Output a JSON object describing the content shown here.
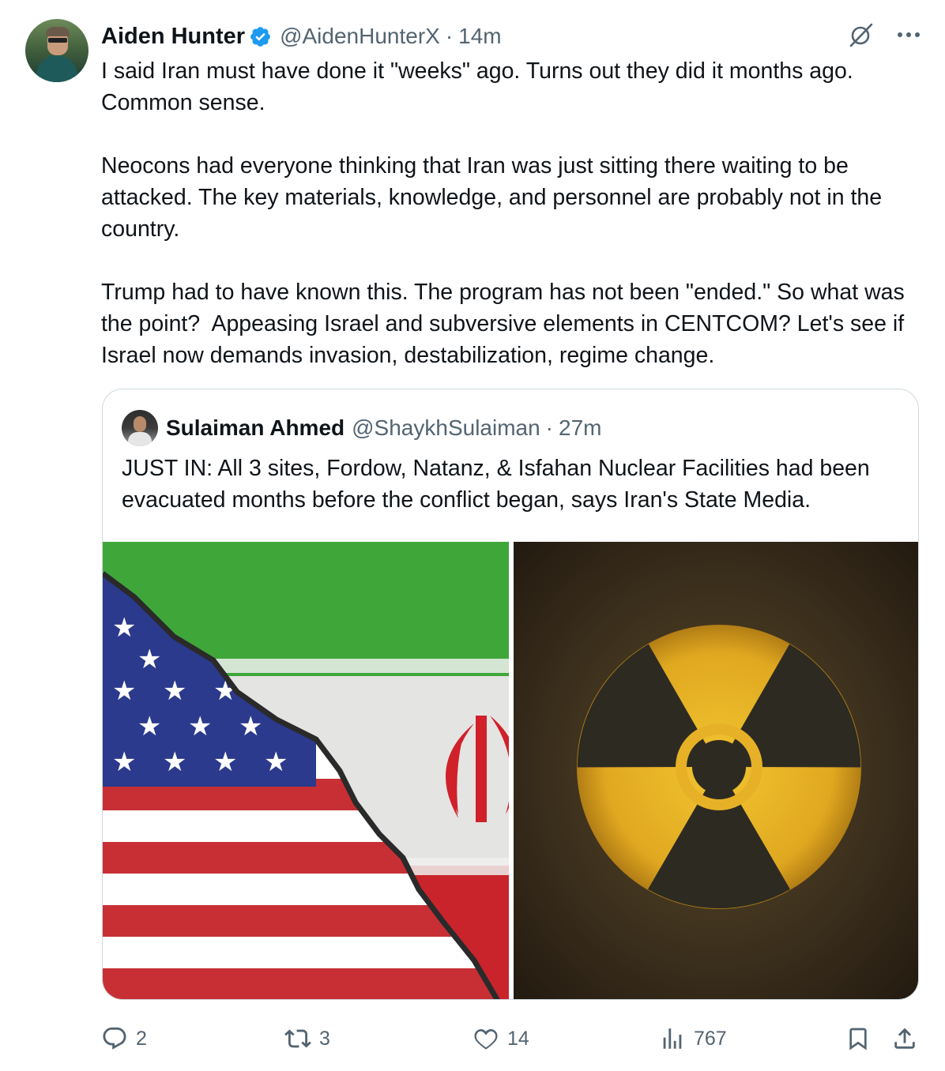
{
  "tweet": {
    "author_name": "Aiden Hunter",
    "handle": "@AidenHunterX",
    "separator": "·",
    "time": "14m",
    "text": "I said Iran must have done it \"weeks\" ago. Turns out they did it months ago. Common sense.\n\nNeocons had everyone thinking that Iran was just sitting there waiting to be attacked. The key materials, knowledge, and personnel are probably not in the country.\n\nTrump had to have known this. The program has not been \"ended.\" So what was the point?  Appeasing Israel and subversive elements in CENTCOM? Let's see if Israel now demands invasion, destabilization, regime change."
  },
  "quote": {
    "author_name": "Sulaiman Ahmed",
    "handle": "@ShaykhSulaiman",
    "separator": "·",
    "time": "27m",
    "text": "JUST IN: All 3 sites, Fordow, Natanz, & Isfahan Nuclear Facilities had been evacuated months before the conflict began, says Iran's State Media."
  },
  "actions": {
    "replies": "2",
    "reposts": "3",
    "likes": "14",
    "views": "767"
  },
  "colors": {
    "verified": "#1d9bf0",
    "secondary_text": "#536471",
    "border": "#cfd9de"
  },
  "icons": [
    "verified-badge-icon",
    "grok-icon",
    "more-icon",
    "reply-icon",
    "repost-icon",
    "like-icon",
    "views-icon",
    "bookmark-icon",
    "share-icon"
  ]
}
